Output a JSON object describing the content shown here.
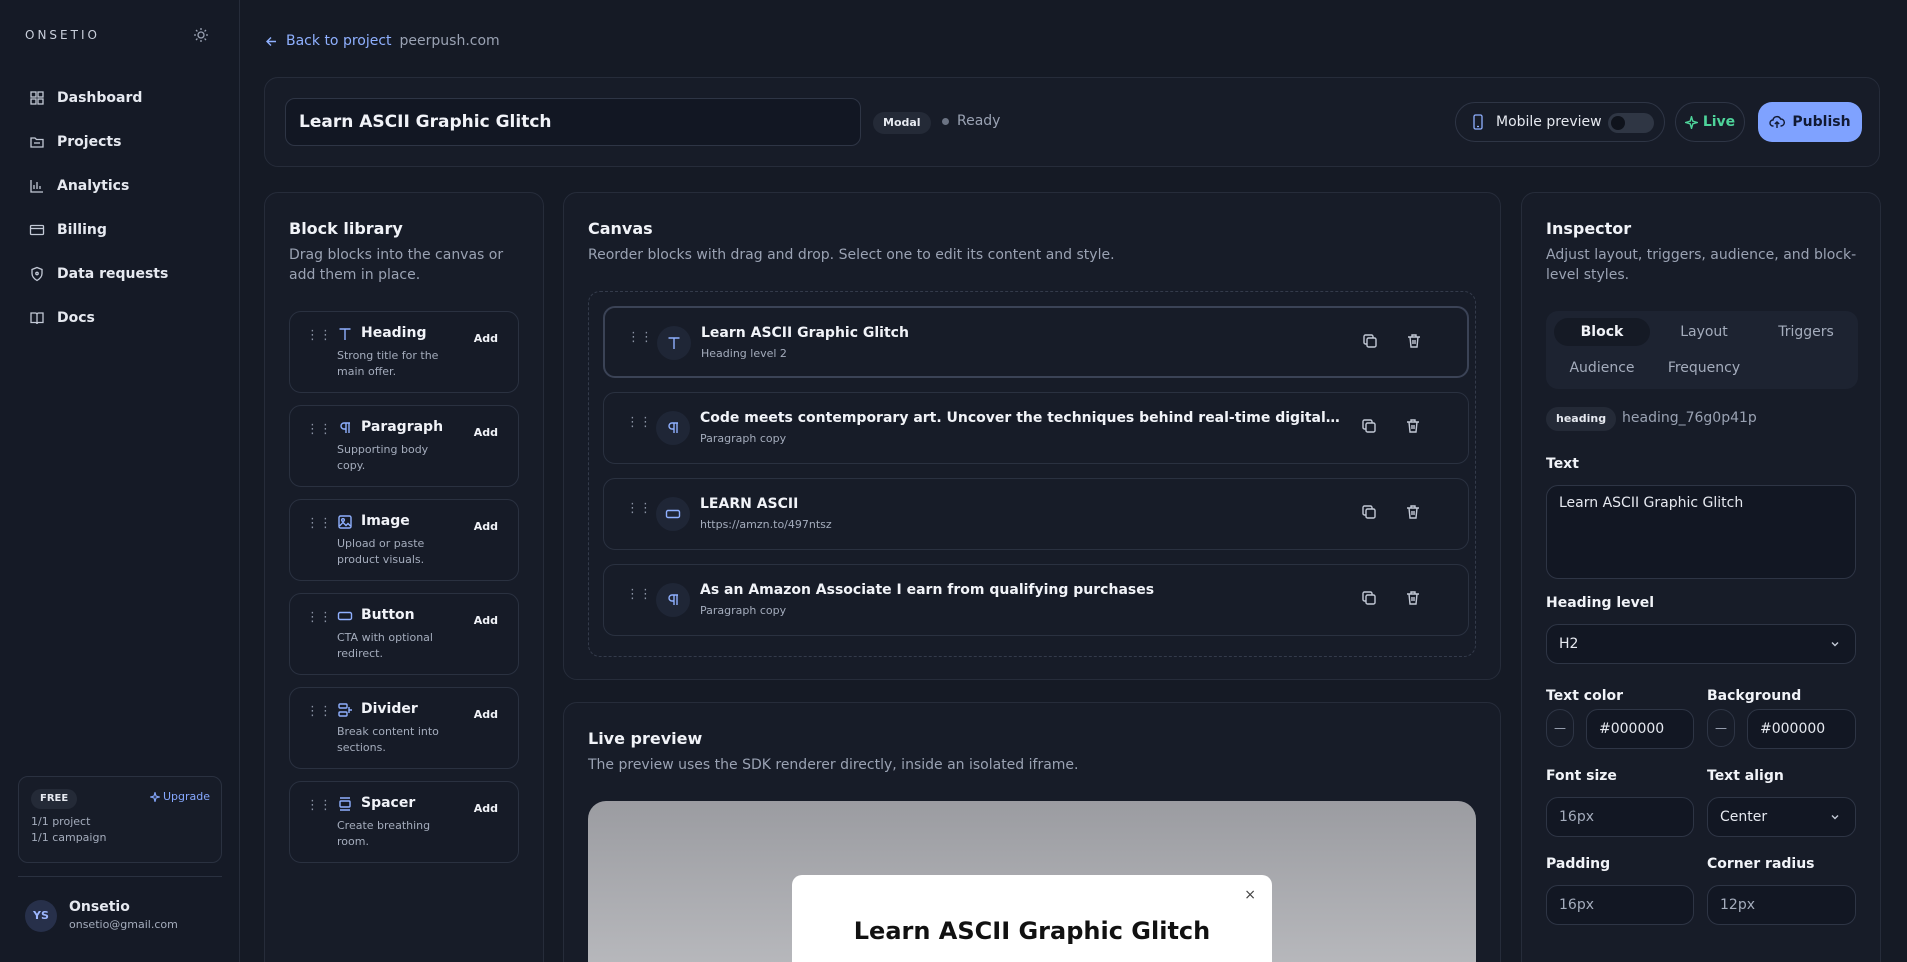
{
  "sidebar": {
    "brand": "ONSETIO",
    "items": [
      {
        "label": "Dashboard",
        "icon": "dashboard-icon"
      },
      {
        "label": "Projects",
        "icon": "folder-icon"
      },
      {
        "label": "Analytics",
        "icon": "chart-icon"
      },
      {
        "label": "Billing",
        "icon": "credit-card-icon"
      },
      {
        "label": "Data requests",
        "icon": "shield-icon"
      },
      {
        "label": "Docs",
        "icon": "book-icon"
      }
    ],
    "plan": {
      "badge": "FREE",
      "upgrade": "Upgrade",
      "projects": "1/1 project",
      "campaigns": "1/1 campaign"
    },
    "user": {
      "initials": "YS",
      "name": "Onsetio",
      "email": "onsetio@gmail.com"
    }
  },
  "topbar": {
    "back_label": "Back to project",
    "domain": "peerpush.com"
  },
  "header": {
    "title": "Learn ASCII Graphic Glitch",
    "type_badge": "Modal",
    "status": "Ready",
    "mobile_preview": "Mobile preview",
    "mobile_preview_on": false,
    "live": "Live",
    "publish": "Publish"
  },
  "library": {
    "title": "Block library",
    "description": "Drag blocks into the canvas or add them in place.",
    "add_label": "Add",
    "items": [
      {
        "name": "Heading",
        "desc": "Strong title for the main offer.",
        "icon": "heading-icon"
      },
      {
        "name": "Paragraph",
        "desc": "Supporting body copy.",
        "icon": "paragraph-icon"
      },
      {
        "name": "Image",
        "desc": "Upload or paste product visuals.",
        "icon": "image-icon"
      },
      {
        "name": "Button",
        "desc": "CTA with optional redirect.",
        "icon": "button-icon"
      },
      {
        "name": "Divider",
        "desc": "Break content into sections.",
        "icon": "divider-icon"
      },
      {
        "name": "Spacer",
        "desc": "Create breathing room.",
        "icon": "spacer-icon"
      }
    ]
  },
  "canvas": {
    "title": "Canvas",
    "description": "Reorder blocks with drag and drop. Select one to edit its content and style.",
    "blocks": [
      {
        "title": "Learn ASCII Graphic Glitch",
        "subtitle": "Heading level 2",
        "icon": "heading-icon",
        "selected": true
      },
      {
        "title": "Code meets contemporary art. Uncover the techniques behind real-time digital pattern generation, ...",
        "subtitle": "Paragraph copy",
        "icon": "paragraph-icon",
        "selected": false
      },
      {
        "title": "LEARN ASCII",
        "subtitle": "https://amzn.to/497ntsz",
        "icon": "button-icon",
        "selected": false
      },
      {
        "title": "As an Amazon Associate I earn from qualifying purchases",
        "subtitle": "Paragraph copy",
        "icon": "paragraph-icon",
        "selected": false
      }
    ]
  },
  "preview": {
    "title": "Live preview",
    "description": "The preview uses the SDK renderer directly, inside an isolated iframe.",
    "modal_close": "×",
    "modal_title": "Learn ASCII Graphic Glitch"
  },
  "inspector": {
    "title": "Inspector",
    "description": "Adjust layout, triggers, audience, and block-level styles.",
    "tabs": [
      "Block",
      "Layout",
      "Triggers",
      "Audience",
      "Frequency"
    ],
    "active_tab": "Block",
    "block_type": "heading",
    "block_id": "heading_76g0p41p",
    "text_label": "Text",
    "text_value": "Learn ASCII Graphic Glitch",
    "heading_level_label": "Heading level",
    "heading_level": "H2",
    "text_color_label": "Text color",
    "text_color": "#000000",
    "background_label": "Background",
    "background": "#000000",
    "swatch_placeholder": "—",
    "font_size_label": "Font size",
    "font_size": "16px",
    "text_align_label": "Text align",
    "text_align": "Center",
    "padding_label": "Padding",
    "padding": "16px",
    "corner_radius_label": "Corner radius",
    "corner_radius": "12px"
  },
  "colors": {
    "accent": "#7fa2ff",
    "live": "#4ed39a",
    "background": "#151a25",
    "card": "#171c28"
  }
}
